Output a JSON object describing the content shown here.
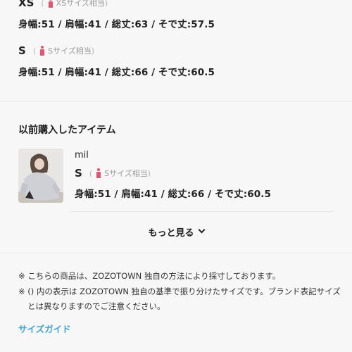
{
  "sizes": [
    {
      "name": "XS",
      "equiv": "XSサイズ相当",
      "measurements": "身幅:51 / 肩幅:41 / 総丈:63 / そで丈:57.5"
    },
    {
      "name": "S",
      "equiv": "Sサイズ相当",
      "measurements": "身幅:51 / 肩幅:41 / 総丈:66 / そで丈:60.5"
    }
  ],
  "paren_open": "(",
  "paren_close": ")",
  "purchased": {
    "title": "以前購入したアイテム",
    "item": {
      "brand": "mil",
      "size": "S",
      "equiv": "Sサイズ相当",
      "measurements": "身幅:51 / 肩幅:41 / 総丈:66 / そで丈:60.5"
    }
  },
  "show_more_label": "もっと見る",
  "notes": [
    "※ こちらの商品は、ZOZOTOWN 独自の方法により採寸しております。",
    "※ () 内の表示は ZOZOTOWN 独自の基準で振り分けたサイズです。ブランド表記サイズとは異なりますのでご注意ください。"
  ],
  "size_guide_label": "サイズガイド",
  "colors": {
    "accent_link": "#43a4cf",
    "person_icon": "#e25470",
    "background": "#f7f7f7"
  }
}
